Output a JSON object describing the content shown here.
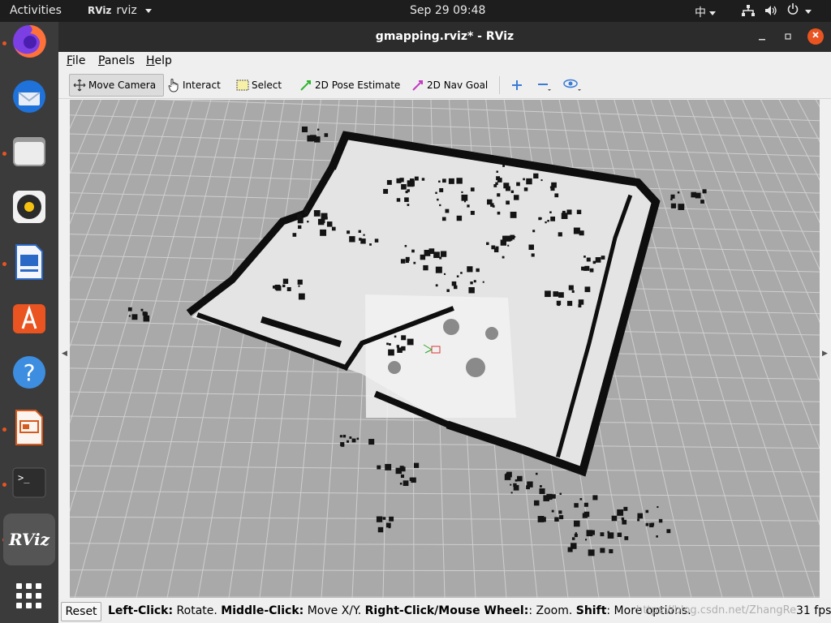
{
  "topbar": {
    "activities": "Activities",
    "app_name": "rviz",
    "app_icon_text": "RViz",
    "clock": "Sep 29  09:48",
    "input_method": "中"
  },
  "dock": {
    "items": [
      "firefox-icon",
      "thunderbird-icon",
      "files-icon",
      "rhythmbox-icon",
      "writer-icon",
      "software-icon",
      "help-icon",
      "impress-icon",
      "terminal-icon",
      "rviz-icon",
      "show-apps-icon"
    ],
    "rviz_label": "RViz",
    "terminal_label": ">_"
  },
  "window": {
    "title": "gmapping.rviz* - RViz"
  },
  "menubar": {
    "file_first": "F",
    "file_rest": "ile",
    "panels_first": "P",
    "panels_rest": "anels",
    "help_first": "H",
    "help_rest": "elp"
  },
  "toolbar": {
    "move_camera": "Move Camera",
    "interact": "Interact",
    "select": "Select",
    "pose_estimate": "2D Pose Estimate",
    "nav_goal": "2D Nav Goal",
    "pose_color": "#2fb52f",
    "nav_color": "#c23ac2"
  },
  "statusbar": {
    "reset": "Reset",
    "left_click": "Left-Click:",
    "left_action": " Rotate. ",
    "middle_click": "Middle-Click:",
    "middle_action": " Move X/Y. ",
    "right_click": "Right-Click/Mouse Wheel:",
    "right_action": ": Zoom. ",
    "shift": "Shift",
    "shift_action": ": More options.",
    "watermark": "https://blog.csdn.net/ZhangRe",
    "fps": "31 fps"
  },
  "colors": {
    "accent": "#e95420",
    "grid_bg": "#a8a8a8",
    "map_free": "#e6e6e6",
    "map_occupied": "#111111"
  }
}
